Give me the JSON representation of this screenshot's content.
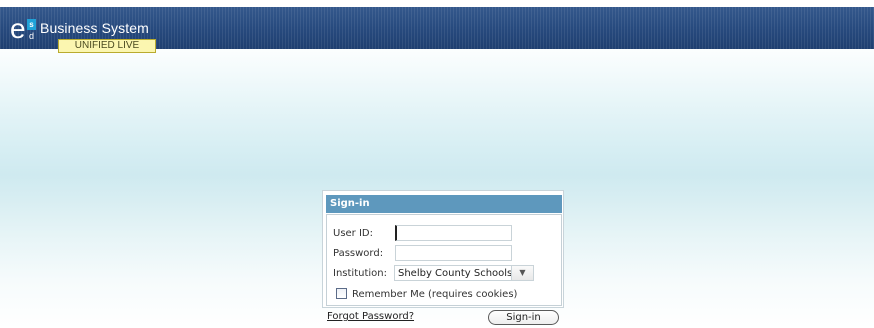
{
  "header": {
    "logo": {
      "letter": "e",
      "superscript": "s",
      "subscript": "d"
    },
    "title": "Business System",
    "env_badge": "UNIFIED LIVE"
  },
  "signin": {
    "heading": "Sign-in",
    "user_id_label": "User ID:",
    "user_id_value": "",
    "password_label": "Password:",
    "password_value": "",
    "institution_label": "Institution:",
    "institution_value": "Shelby County Schools",
    "remember_label": "Remember Me (requires cookies)",
    "remember_checked": false,
    "forgot_link": "Forgot Password?",
    "submit_label": "Sign-in"
  },
  "colors": {
    "header_bg": "#274a7e",
    "signin_header_bg": "#5e98bd",
    "env_badge_bg": "#fbf6b0"
  }
}
